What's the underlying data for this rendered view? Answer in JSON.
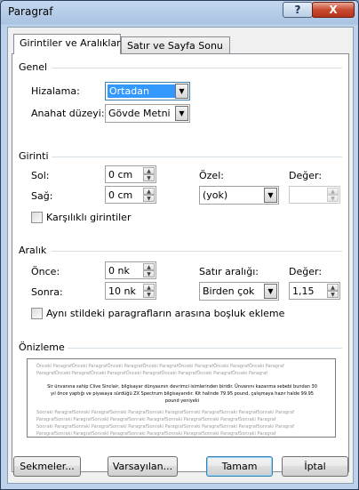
{
  "window": {
    "title": "Paragraf"
  },
  "titlebar": {
    "help_glyph": "?",
    "close_glyph": "X"
  },
  "tabs": [
    {
      "label": "Girintiler ve Aralıklar",
      "active": true
    },
    {
      "label": "Satır ve Sayfa Sonu",
      "active": false
    }
  ],
  "general": {
    "title": "Genel",
    "alignment_label": "Hizalama:",
    "alignment_value": "Ortadan",
    "outline_label": "Anahat düzeyi:",
    "outline_value": "Gövde Metni"
  },
  "indent": {
    "title": "Girinti",
    "left_label": "Sol:",
    "left_value": "0 cm",
    "right_label": "Sağ:",
    "right_value": "0 cm",
    "special_label": "Özel:",
    "special_value": "(yok)",
    "by_label": "Değer:",
    "by_value": "",
    "mirror_label": "Karşılıklı girintiler"
  },
  "spacing": {
    "title": "Aralık",
    "before_label": "Önce:",
    "before_value": "0 nk",
    "after_label": "Sonra:",
    "after_value": "10 nk",
    "line_label": "Satır aralığı:",
    "line_value": "Birden çok",
    "at_label": "Değer:",
    "at_value": "1,15",
    "dont_add_label": "Aynı stildeki paragrafların arasına boşluk ekleme"
  },
  "preview": {
    "title": "Önizleme",
    "prev_line1": "Önceki ParagrafÖnceki ParagrafÖnceki ParagrafÖnceki ParagrafÖnceki ParagrafÖnceki ParagrafÖnceki Paragraf",
    "prev_line2": "ParagrafÖnceki ParagrafÖnceki ParagrafÖnceki ParagrafÖnceki ParagrafÖnceki ParagrafÖnceki Paragraf",
    "sample_line1": "Sir ünvanına sahip Clive Sinclair, bilgisayar dünyasının devrimci isimlerinden biridir. Ünvanını kazanma sebebi bundan 30",
    "sample_line2": "yıl önce yaptığı ve piyasaya sürdüğü ZX Spectrum bilgisayarıdır. Kit halinde 79.95 pound, çalışmaya hazır halde 99.95",
    "sample_line3": "pound yeniyeki",
    "next_line1": "Sonraki ParagrafSonraki ParagrafSonraki ParagrafSonraki ParagrafSonraki ParagrafSonraki ParagrafSonraki Paragraf",
    "next_line2": "ParagrafSonraki ParagrafSonraki ParagrafSonraki ParagrafSonraki ParagrafSonraki ParagrafSonraki Paragraf",
    "next_line3": "Sonraki ParagrafSonraki ParagrafSonraki ParagrafSonraki ParagrafSonraki ParagrafSonraki ParagrafSonraki Paragraf",
    "next_line4": "ParagrafSonraki ParagrafSonraki ParagrafSonraki ParagrafSonraki ParagrafSonraki ParagrafSonraki Paragraf"
  },
  "buttons": {
    "tabs_label": "Sekmeler...",
    "default_label": "Varsayılan...",
    "ok_label": "Tamam",
    "cancel_label": "İptal"
  },
  "icons": {
    "combo_arrow": "chevron-down-icon",
    "spin_up": "spin-up-icon",
    "spin_down": "spin-down-icon"
  },
  "colors": {
    "titlebar": "#a9c3e2",
    "close_button": "#c84a2f",
    "selection": "#3399ff",
    "default_button_border": "#3c7fb1"
  }
}
